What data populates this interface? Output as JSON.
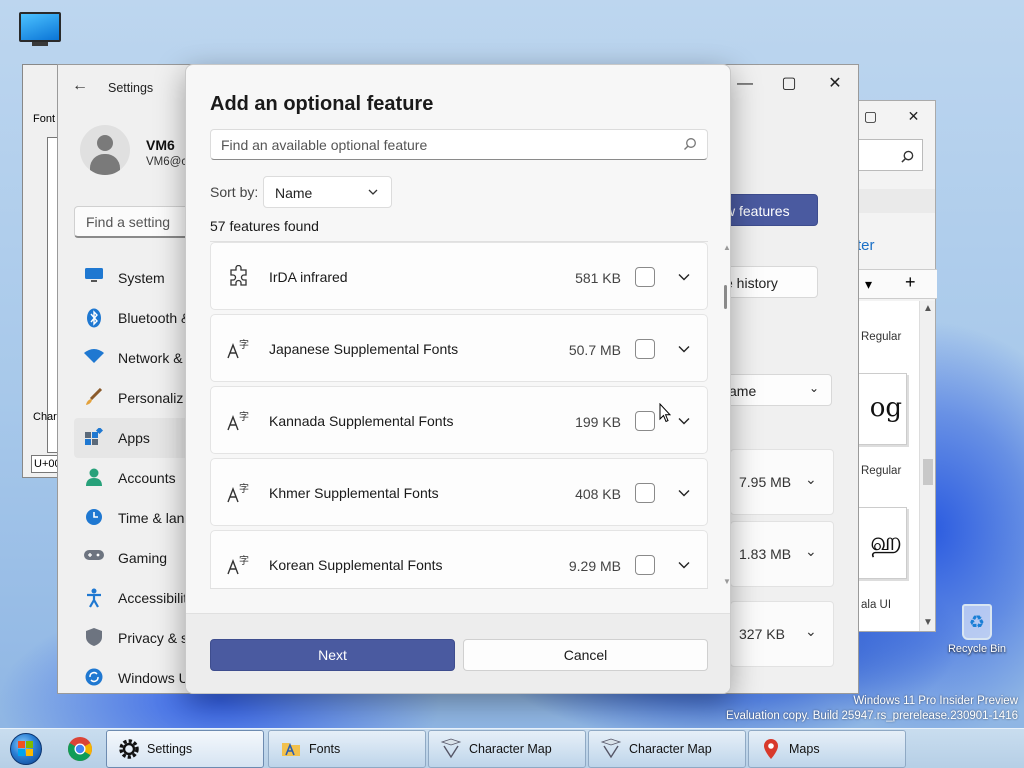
{
  "desktop": {
    "this_pc_label": "This PC",
    "recycle_bin_label": "Recycle Bin",
    "watermark_line1": "Windows 11 Pro Insider Preview",
    "watermark_line2": "Evaluation copy. Build 25947.rs_prerelease.230901-1416"
  },
  "charmap_window": {
    "font_label": "Font",
    "characters_label": "Chara",
    "code_field": "U+00"
  },
  "fonts_window": {
    "search_icon": "search-icon",
    "link_text": "ter",
    "font_items": [
      {
        "name": "Regular",
        "preview": "og"
      },
      {
        "name": "Regular",
        "preview": "ஹ"
      },
      {
        "name": "ala UI"
      }
    ]
  },
  "settings": {
    "title": "Settings",
    "user_name": "VM6",
    "user_email": "VM6@c",
    "search_placeholder": "Find a setting",
    "nav": [
      {
        "label": "System",
        "icon": "system-icon"
      },
      {
        "label": "Bluetooth &",
        "icon": "bluetooth-icon"
      },
      {
        "label": "Network &",
        "icon": "network-icon"
      },
      {
        "label": "Personaliz",
        "icon": "personalization-icon"
      },
      {
        "label": "Apps",
        "icon": "apps-icon",
        "active": true
      },
      {
        "label": "Accounts",
        "icon": "accounts-icon"
      },
      {
        "label": "Time & lan",
        "icon": "time-icon"
      },
      {
        "label": "Gaming",
        "icon": "gaming-icon"
      },
      {
        "label": "Accessibilit",
        "icon": "accessibility-icon"
      },
      {
        "label": "Privacy & s",
        "icon": "privacy-icon"
      },
      {
        "label": "Windows U",
        "icon": "windows-update-icon"
      }
    ],
    "view_features_button": "w features",
    "see_history_button": "e history",
    "sort_partial": "ame",
    "sizes": [
      "7.95 MB",
      "1.83 MB",
      "327 KB"
    ]
  },
  "dialog": {
    "title": "Add an optional feature",
    "search_placeholder": "Find an available optional feature",
    "sort_label": "Sort by:",
    "sort_value": "Name",
    "count_text": "57 features found",
    "features": [
      {
        "name": "IrDA infrared",
        "size": "581 KB",
        "icon": "puzzle-icon",
        "checked": false
      },
      {
        "name": "Japanese Supplemental Fonts",
        "size": "50.7 MB",
        "icon": "font-icon",
        "checked": false
      },
      {
        "name": "Kannada Supplemental Fonts",
        "size": "199 KB",
        "icon": "font-icon",
        "checked": false
      },
      {
        "name": "Khmer Supplemental Fonts",
        "size": "408 KB",
        "icon": "font-icon",
        "checked": false
      },
      {
        "name": "Korean Supplemental Fonts",
        "size": "9.29 MB",
        "icon": "font-icon",
        "checked": false
      }
    ],
    "next_label": "Next",
    "cancel_label": "Cancel",
    "accent_color": "#4a5aa0"
  },
  "taskbar": {
    "tasks": [
      {
        "label": "Settings",
        "icon": "gear-icon",
        "active": true
      },
      {
        "label": "Fonts",
        "icon": "folder-icon"
      },
      {
        "label": "Character Map",
        "icon": "charmap-icon"
      },
      {
        "label": "Character Map",
        "icon": "charmap-icon"
      },
      {
        "label": "Maps",
        "icon": "map-pin-icon"
      }
    ],
    "pinned": [
      {
        "icon": "chrome-icon"
      }
    ]
  }
}
